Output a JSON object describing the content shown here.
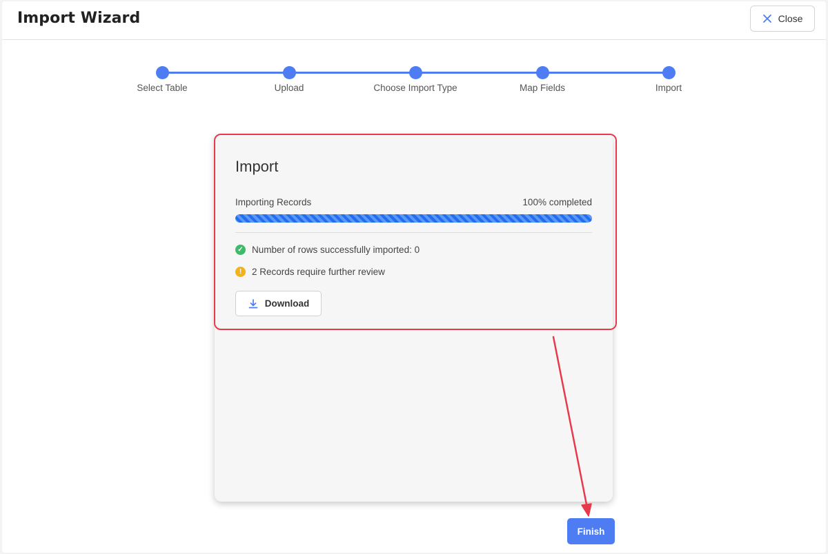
{
  "header": {
    "title": "Import Wizard",
    "close_label": "Close"
  },
  "stepper": {
    "steps": [
      {
        "label": "Select Table"
      },
      {
        "label": "Upload"
      },
      {
        "label": "Choose Import Type"
      },
      {
        "label": "Map Fields"
      },
      {
        "label": "Import"
      }
    ]
  },
  "import_card": {
    "title": "Import",
    "progress_label": "Importing Records",
    "progress_text": "100% completed",
    "progress_fraction": 1.0,
    "success_message": "Number of rows successfully imported: 0",
    "warning_message": "2 Records require further review",
    "download_label": "Download"
  },
  "footer": {
    "finish_label": "Finish"
  },
  "colors": {
    "accent": "#4d7cf3",
    "progress": "#1f6ff0",
    "success": "#3dbb6a",
    "warning": "#f2b21c",
    "annotation": "#e8394b"
  },
  "icons": {
    "close": "close-icon",
    "success": "check-circle-icon",
    "warning": "exclamation-circle-icon",
    "download": "download-icon"
  }
}
